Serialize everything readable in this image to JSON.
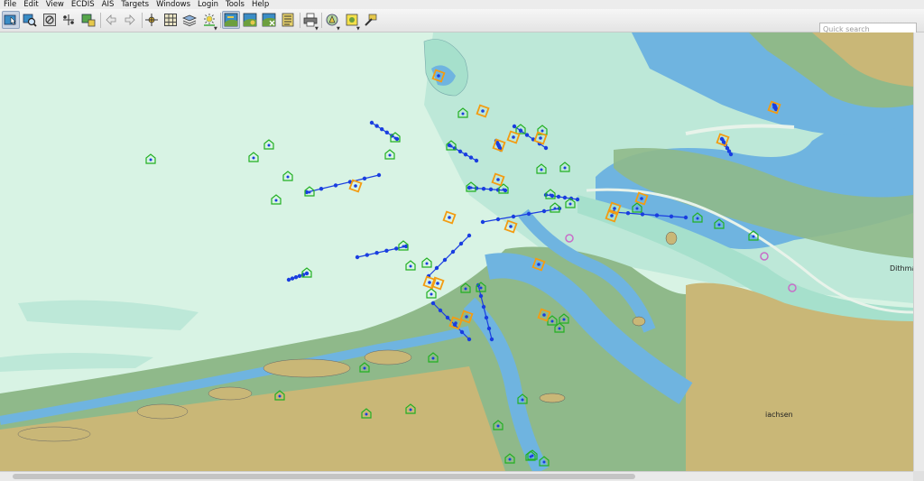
{
  "menu": [
    "File",
    "Edit",
    "View",
    "ECDIS",
    "AIS",
    "Targets",
    "Windows",
    "Login",
    "Tools",
    "Help"
  ],
  "toolbar": {
    "buttons": [
      {
        "name": "select-tool-button",
        "icon": "pointer-map-icon",
        "active": true
      },
      {
        "name": "zoom-tool-button",
        "icon": "zoom-map-icon",
        "active": false
      },
      {
        "name": "measure-tool-button",
        "icon": "measure-icon",
        "active": false
      },
      {
        "name": "route-tool-button",
        "icon": "route-icon",
        "active": false
      },
      {
        "name": "pan-tool-button",
        "icon": "pan-hand-icon",
        "active": false
      },
      {
        "name": "back-button",
        "icon": "arrow-left-icon",
        "active": false
      },
      {
        "name": "forward-button",
        "icon": "arrow-right-icon",
        "active": false
      },
      {
        "name": "center-ship-button",
        "icon": "center-icon",
        "active": false
      },
      {
        "name": "grid-button",
        "icon": "grid-icon",
        "active": false
      },
      {
        "name": "layers-button",
        "icon": "layers-icon",
        "active": false
      },
      {
        "name": "day-night-button",
        "icon": "sun-icon",
        "active": false
      },
      {
        "name": "chart-view-1-button",
        "icon": "chart-icon",
        "active": true
      },
      {
        "name": "chart-view-2-button",
        "icon": "chart-icon",
        "active": false
      },
      {
        "name": "chart-view-3-button",
        "icon": "chart-icon",
        "active": false
      },
      {
        "name": "chart-list-button",
        "icon": "list-icon",
        "active": false
      },
      {
        "name": "print-button",
        "icon": "printer-icon",
        "active": false
      },
      {
        "name": "ais-targets-button",
        "icon": "ais-icon",
        "active": false
      },
      {
        "name": "alert-button",
        "icon": "alert-icon",
        "active": false
      },
      {
        "name": "tools-button",
        "icon": "wrench-icon",
        "active": false
      }
    ],
    "search_placeholder": "Quick search"
  },
  "map": {
    "labels": [
      {
        "key": "dithmarschen",
        "text": "Dithma"
      },
      {
        "key": "niedersachsen",
        "text": "iachsen"
      }
    ],
    "colors": {
      "deep_water": "#bde8d8",
      "shallow": "#a6e0cc",
      "channel": "#6fb4e0",
      "tidal_flat": "#8fb98a",
      "land": "#c9b777",
      "route": "#1a3ee0",
      "ais_target": "#22b022",
      "highlight": "#f39c12"
    }
  }
}
